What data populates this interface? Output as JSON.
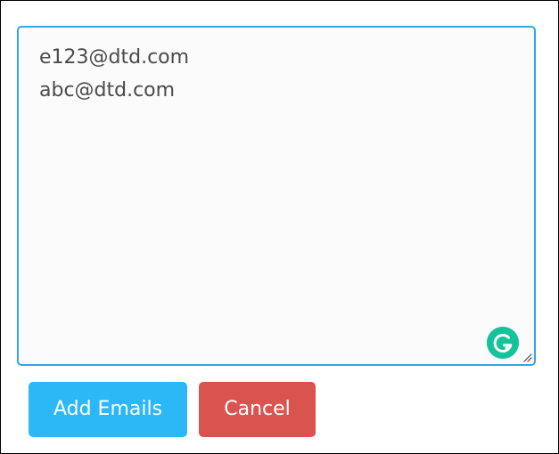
{
  "email_input": {
    "lines": [
      "e123@dtd.com",
      "abc@dtd.com"
    ]
  },
  "actions": {
    "add_label": "Add Emails",
    "cancel_label": "Cancel"
  },
  "icons": {
    "grammar": "grammar-assistant-icon",
    "resize": "resize-handle-icon"
  },
  "colors": {
    "input_border": "#2ea8e6",
    "input_background": "#fbfbfb",
    "text": "#4a4a4a",
    "add_button": "#2cb7f6",
    "cancel_button": "#d9534f",
    "grammar_icon": "#15c39a"
  }
}
